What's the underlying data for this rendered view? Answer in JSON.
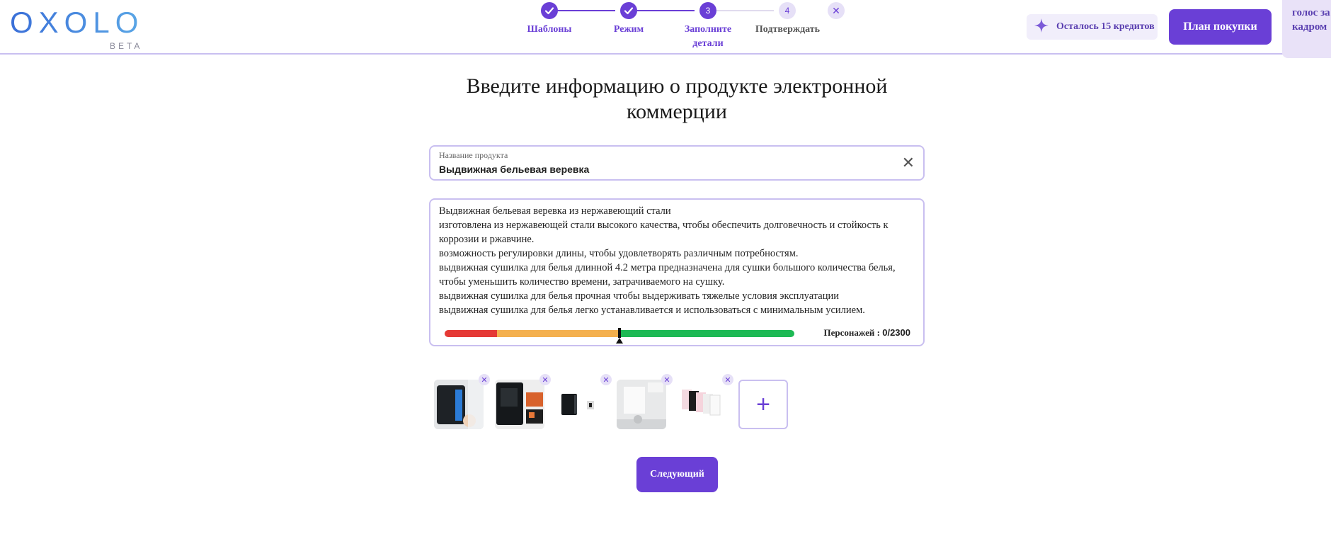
{
  "logo": {
    "name": "OXOLO",
    "badge": "BETA"
  },
  "stepper": {
    "steps": [
      {
        "number": "1",
        "label": "Шаблоны",
        "state": "done"
      },
      {
        "number": "2",
        "label": "Режим",
        "state": "done"
      },
      {
        "number": "3",
        "label": "Заполните детали",
        "state": "active"
      },
      {
        "number": "4",
        "label": "Подтверждать",
        "state": "todo"
      }
    ],
    "close_icon": "close-icon"
  },
  "header": {
    "credits": "Осталось 15 кредитов",
    "plan_button": "План покупки",
    "voice_button": "голос за кадром"
  },
  "main": {
    "title": "Введите информацию о продукте электронной коммерции",
    "product_name_label": "Название продукта",
    "product_name_value": "Выдвижная бельевая веревка",
    "description": "Выдвижная бельевая веревка из нержавеющий стали\nизготовлена из нержавеющей стали высокого качества, чтобы обеспечить долговечность и стойкость к коррозии и ржавчине.\nвозможность регулировки длины, чтобы удовлетворять различным потребностям.\nвыдвижная сушилка для белья длинной 4.2 метра предназначена для сушки большого количества белья, чтобы уменьшить количество времени, затрачиваемого на сушку.\nвыдвижная сушилка для белья прочная чтобы выдерживать тяжелые условия эксплуатации\nвыдвижная сушилка для белья легко устанавливается и использоваться с минимальным усилием.",
    "char_count_label": "Персонажей :",
    "char_count_value": "0/2300",
    "meter_level": 0.5,
    "next_button": "Следующий",
    "add_image_symbol": "+"
  },
  "colors": {
    "accent": "#6a3fd6",
    "accent_light": "#e6e0f7",
    "meter_red": "#e53935",
    "meter_orange": "#f4b04e",
    "meter_green": "#1db954"
  }
}
